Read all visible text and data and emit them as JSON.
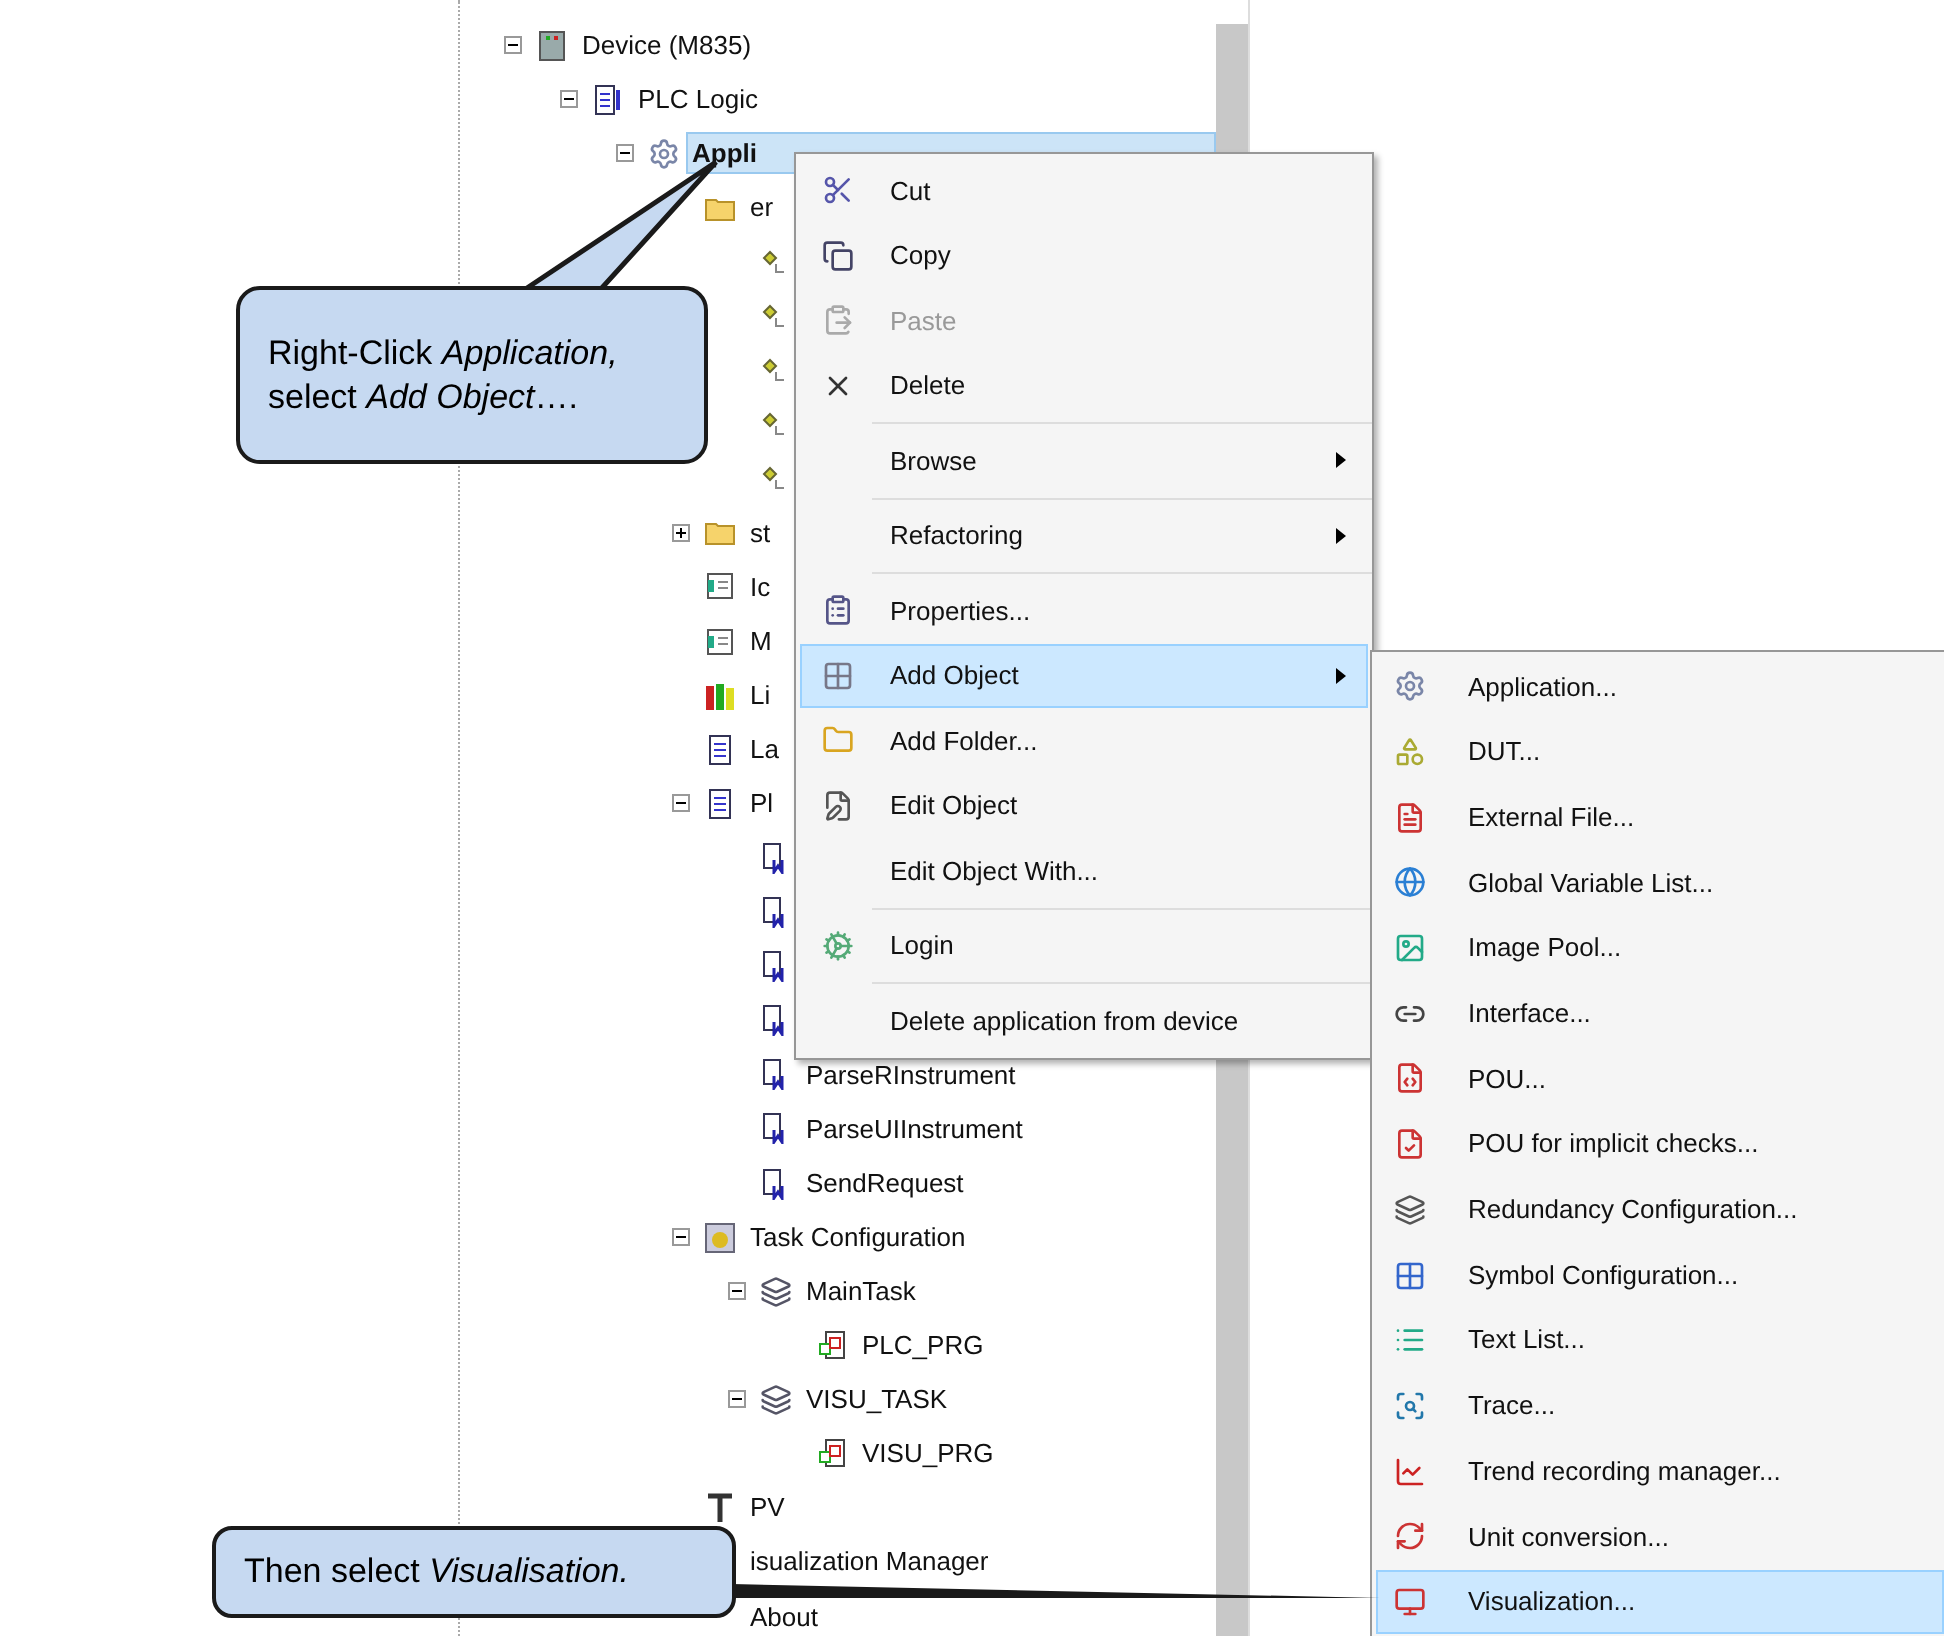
{
  "tree": [
    {
      "kind": "device",
      "label": "Device (M835)",
      "expanded": true,
      "selected": false,
      "children": [
        {
          "kind": "plc",
          "label": "PLC Logic",
          "expanded": true,
          "selected": false,
          "children": [
            {
              "kind": "application",
              "label": "Appli",
              "expanded": true,
              "selected": true,
              "children": [
                {
                  "kind": "folder",
                  "label": "er",
                  "selected": false,
                  "children": [
                    {
                      "kind": "dut"
                    },
                    {
                      "kind": "dut"
                    },
                    {
                      "kind": "dut"
                    },
                    {
                      "kind": "dut"
                    },
                    {
                      "kind": "dut"
                    }
                  ]
                },
                {
                  "kind": "folder",
                  "label": "st",
                  "expanded": false,
                  "selected": false
                },
                {
                  "kind": "textlist",
                  "label": "Ic",
                  "selected": false
                },
                {
                  "kind": "textlist",
                  "label": "M",
                  "selected": false
                },
                {
                  "kind": "library",
                  "label": "Li",
                  "selected": false
                },
                {
                  "kind": "doc",
                  "label": "La",
                  "selected": false
                },
                {
                  "kind": "doc",
                  "label": "Pl",
                  "expanded": true,
                  "selected": false,
                  "children": [
                    {
                      "kind": "method"
                    },
                    {
                      "kind": "method"
                    },
                    {
                      "kind": "method"
                    },
                    {
                      "kind": "method"
                    },
                    {
                      "kind": "method",
                      "label": "ParseRInstrument",
                      "selected": false
                    },
                    {
                      "kind": "method",
                      "label": "ParseUIInstrument",
                      "selected": false
                    },
                    {
                      "kind": "method",
                      "label": "SendRequest",
                      "selected": false
                    }
                  ]
                },
                {
                  "kind": "taskconfig",
                  "label": "Task Configuration",
                  "expanded": true,
                  "selected": false,
                  "children": [
                    {
                      "kind": "task",
                      "label": "MainTask",
                      "expanded": true,
                      "selected": false,
                      "children": [
                        {
                          "kind": "pou",
                          "label": "PLC_PRG",
                          "selected": false
                        }
                      ]
                    },
                    {
                      "kind": "task",
                      "label": "VISU_TASK",
                      "expanded": true,
                      "selected": false,
                      "children": [
                        {
                          "kind": "pou",
                          "label": "VISU_PRG",
                          "selected": false
                        }
                      ]
                    }
                  ]
                },
                {
                  "kind": "pv",
                  "label": "PV",
                  "selected": false
                },
                {
                  "kind": "none",
                  "label": "isualization Manager",
                  "selected": false
                },
                {
                  "kind": "none",
                  "label": "About",
                  "selected": false
                }
              ]
            }
          ]
        }
      ]
    }
  ],
  "context_menu": {
    "items": [
      {
        "kind": "item",
        "label": "Cut",
        "disabled": false,
        "submenu": false,
        "selected": false
      },
      {
        "kind": "item",
        "label": "Copy",
        "disabled": false,
        "submenu": false,
        "selected": false
      },
      {
        "kind": "item",
        "label": "Paste",
        "disabled": true,
        "submenu": false,
        "selected": false
      },
      {
        "kind": "item",
        "label": "Delete",
        "disabled": false,
        "submenu": false,
        "selected": false
      },
      {
        "kind": "separator"
      },
      {
        "kind": "item",
        "label": "Browse",
        "disabled": false,
        "submenu": true,
        "selected": false
      },
      {
        "kind": "separator"
      },
      {
        "kind": "item",
        "label": "Refactoring",
        "disabled": false,
        "submenu": true,
        "selected": false
      },
      {
        "kind": "separator"
      },
      {
        "kind": "item",
        "label": "Properties...",
        "disabled": false,
        "submenu": false,
        "selected": false
      },
      {
        "kind": "item",
        "label": "Add Object",
        "disabled": false,
        "submenu": true,
        "selected": true
      },
      {
        "kind": "item",
        "label": "Add Folder...",
        "disabled": false,
        "submenu": false,
        "selected": false
      },
      {
        "kind": "item",
        "label": "Edit Object",
        "disabled": false,
        "submenu": false,
        "selected": false
      },
      {
        "kind": "item",
        "label": "Edit Object With...",
        "disabled": false,
        "submenu": false,
        "selected": false
      },
      {
        "kind": "separator"
      },
      {
        "kind": "item",
        "label": "Login",
        "disabled": false,
        "submenu": false,
        "selected": false
      },
      {
        "kind": "separator"
      },
      {
        "kind": "item",
        "label": "Delete application from device",
        "disabled": false,
        "submenu": false,
        "selected": false
      }
    ]
  },
  "submenu": {
    "items": [
      {
        "label": "Application...",
        "selected": false
      },
      {
        "label": "DUT...",
        "selected": false
      },
      {
        "label": "External File...",
        "selected": false
      },
      {
        "label": "Global Variable List...",
        "selected": false
      },
      {
        "label": "Image Pool...",
        "selected": false
      },
      {
        "label": "Interface...",
        "selected": false
      },
      {
        "label": "POU...",
        "selected": false
      },
      {
        "label": "POU for implicit checks...",
        "selected": false
      },
      {
        "label": "Redundancy Configuration...",
        "selected": false
      },
      {
        "label": "Symbol Configuration...",
        "selected": false
      },
      {
        "label": "Text List...",
        "selected": false
      },
      {
        "label": "Trace...",
        "selected": false
      },
      {
        "label": "Trend recording manager...",
        "selected": false
      },
      {
        "label": "Unit conversion...",
        "selected": false
      },
      {
        "label": "Visualization...",
        "selected": true
      }
    ]
  },
  "callouts": [
    {
      "text": "Right-Click *Application,* select *Add Object*…."
    },
    {
      "text": "Then select *Visualisation.*"
    }
  ]
}
